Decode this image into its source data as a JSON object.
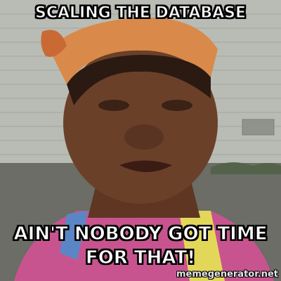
{
  "meme": {
    "top_text": "SCALING THE DATABASE",
    "bottom_text": "AIN'T NOBODY GOT TIME FOR THAT!",
    "watermark": "memegenerator.net"
  },
  "colors": {
    "wall": "#b6b9b2",
    "skin": "#6b4029",
    "headscarf": "#d98a4a",
    "shirt_pink": "#d35da0",
    "shirt_yellow": "#e5d85a",
    "ground": "#5a5c55",
    "text": "#ffffff",
    "text_outline": "#000000"
  }
}
